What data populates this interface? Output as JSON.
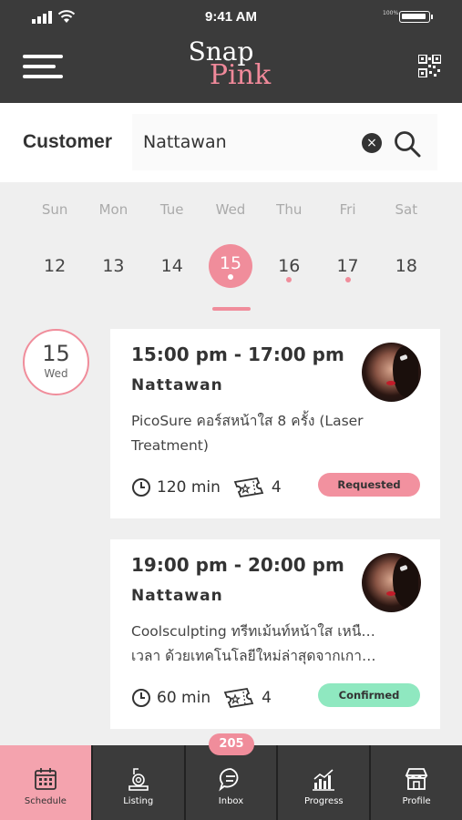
{
  "status_bar": {
    "time": "9:41 AM",
    "battery_pct": "100%"
  },
  "header": {
    "logo_line1": "Snap",
    "logo_line2": "Pink"
  },
  "search": {
    "label": "Customer",
    "value": "Nattawan",
    "clear_symbol": "×"
  },
  "week": {
    "days": [
      "Sun",
      "Mon",
      "Tue",
      "Wed",
      "Thu",
      "Fri",
      "Sat"
    ],
    "dates": [
      "12",
      "13",
      "14",
      "15",
      "16",
      "17",
      "18"
    ],
    "selected": "15"
  },
  "day_badge": {
    "num": "15",
    "name": "Wed"
  },
  "appointments": [
    {
      "time": "15:00 pm - 17:00 pm",
      "name": "Nattawan",
      "desc_line1": "PicoSure คอร์สหน้าใส 8 ครั้ง (Laser",
      "desc_line2": "Treatment)",
      "duration": "120 min",
      "sessions": "4",
      "status": "Requested"
    },
    {
      "time": "19:00 pm - 20:00 pm",
      "name": "Nattawan",
      "desc_line1": "Coolsculpting ทรีทเม้นท์หน้าใส เหนือกาล",
      "desc_line2": "เวลา ด้วยเทคโนโลยีใหม่ล่าสุดจากเกาหลี...",
      "duration": "60 min",
      "sessions": "4",
      "status": "Confirmed"
    }
  ],
  "nav": {
    "inbox_count": "205",
    "items": [
      "Schedule",
      "Listing",
      "Inbox",
      "Progress",
      "Profile"
    ]
  },
  "colors": {
    "accent": "#f08d9b",
    "dark": "#3b3b3b",
    "confirmed": "#8fe8c0"
  }
}
